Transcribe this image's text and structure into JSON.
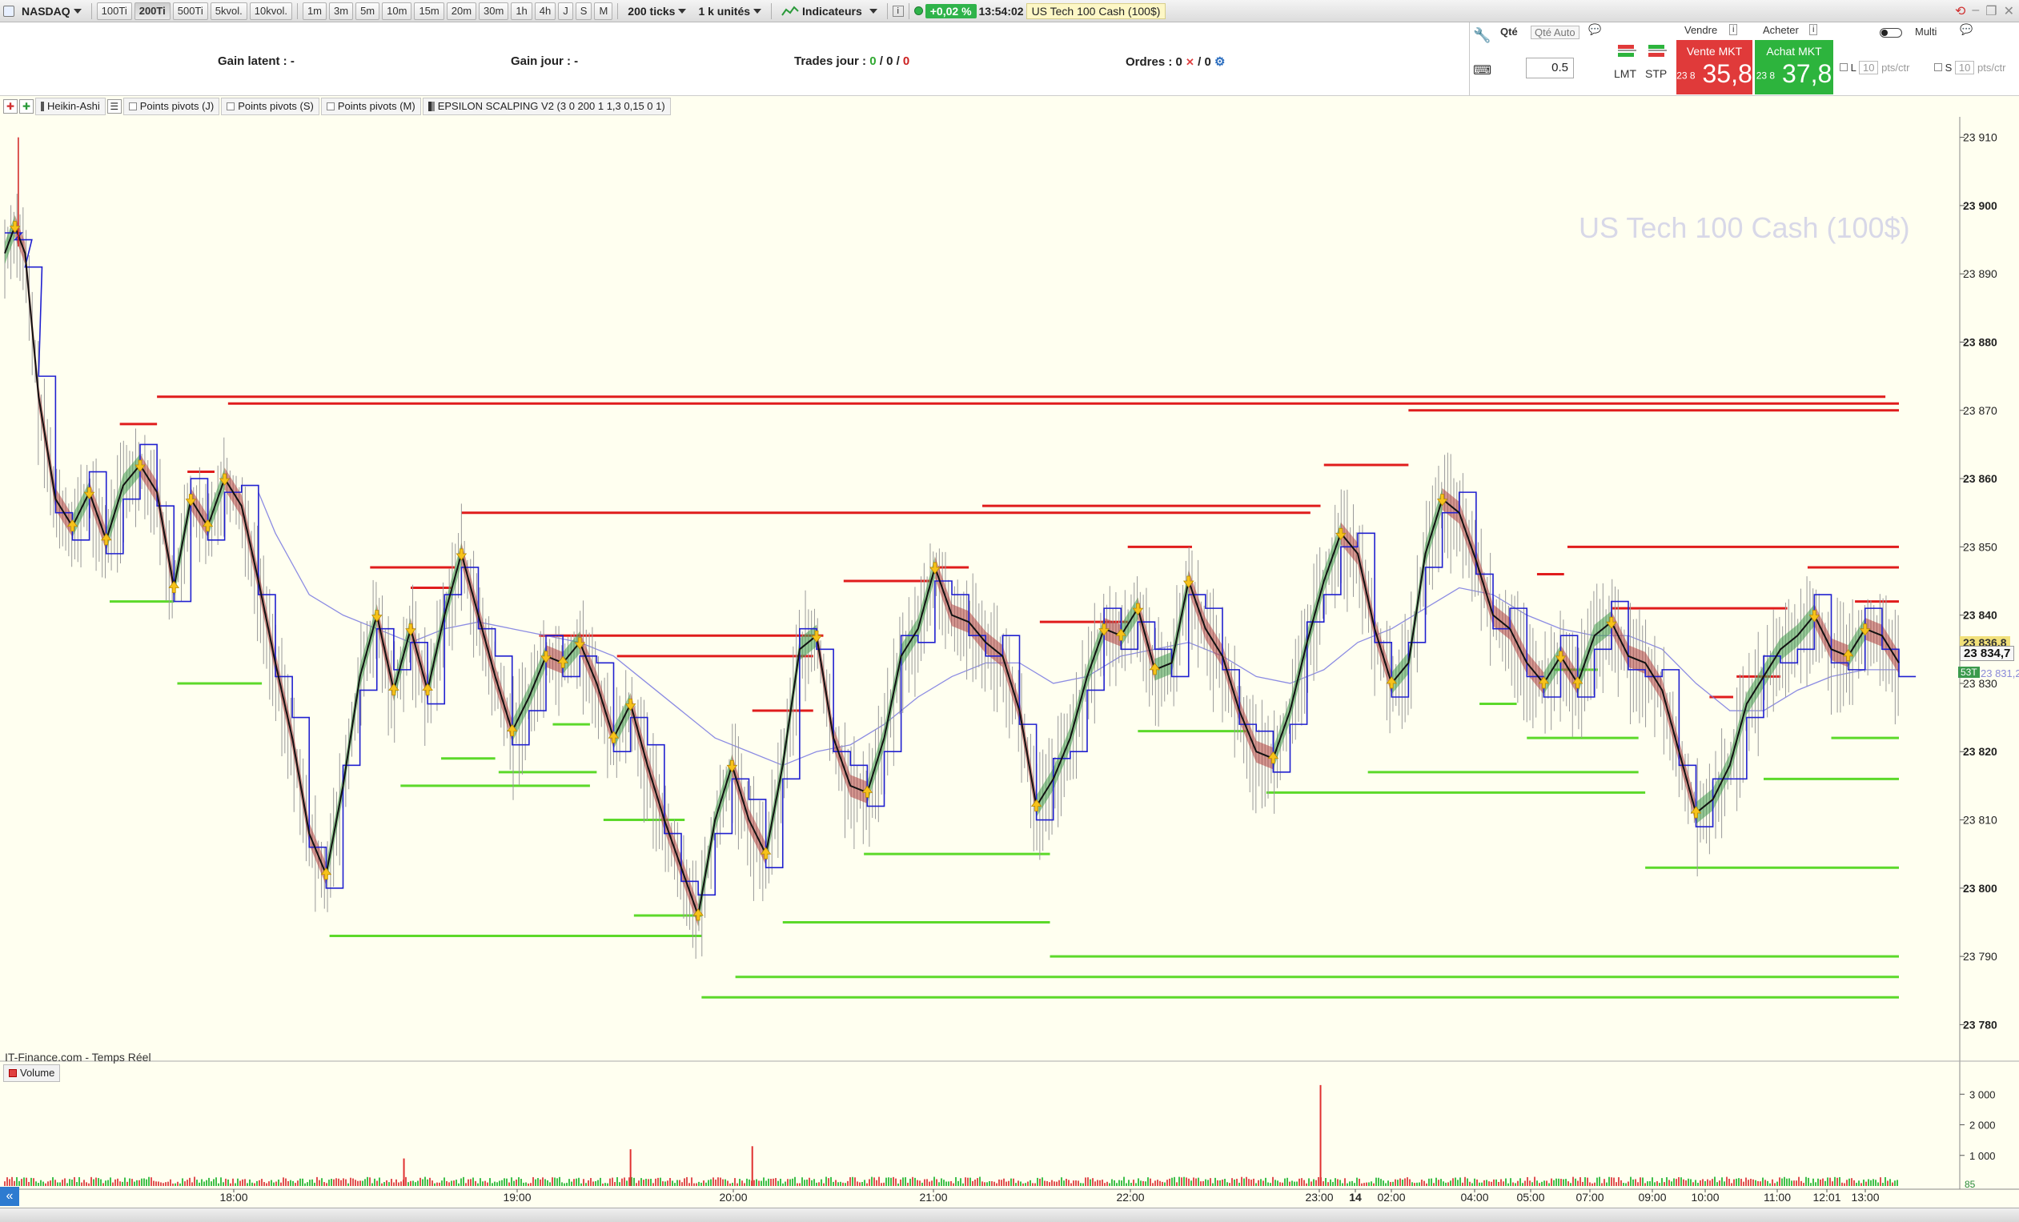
{
  "toolbar": {
    "market": "NASDAQ",
    "tick_buttons": [
      "100Ti",
      "200Ti",
      "500Ti",
      "5kvol.",
      "10kvol."
    ],
    "active_tick": "200Ti",
    "timeframes": [
      "1m",
      "3m",
      "5m",
      "10m",
      "15m",
      "20m",
      "30m",
      "1h",
      "4h",
      "J",
      "S",
      "M"
    ],
    "ticks_select": "200 ticks",
    "units_select": "1 k unités",
    "indicators_label": "Indicateurs",
    "change_pct": "+0,02 %",
    "clock": "13:54:02",
    "instrument": "US Tech 100 Cash (100$)"
  },
  "info": {
    "gain_latent": "Gain latent : -",
    "gain_jour": "Gain jour : -",
    "trades_label": "Trades jour :",
    "trades_values": [
      "0",
      "0",
      "0"
    ],
    "orders_label": "Ordres : 0",
    "orders_second": "/ 0"
  },
  "order_panel": {
    "qty_label": "Qté",
    "qty_value": "0.5",
    "qty_tab": "Qté Auto",
    "lmt": "LMT",
    "stp": "STP",
    "sell_header": "Vendre",
    "buy_header": "Acheter",
    "sell_title": "Vente MKT",
    "buy_title": "Achat MKT",
    "sell_prefix": "23 8",
    "sell_price": "35,8",
    "buy_prefix": "23 8",
    "buy_price": "37,8",
    "multi": "Multi",
    "l_label": "L",
    "s_label": "S",
    "l_value": "10",
    "s_value": "10",
    "pts_unit": "pts/ctr"
  },
  "indicators": {
    "heikin": "Heikin-Ashi",
    "pivots_j": "Points pivots (J)",
    "pivots_s": "Points pivots (S)",
    "pivots_m": "Points pivots (M)",
    "epsilon": "EPSILON SCALPING V2 (3 0 200 1 1,3 0,15 0 1)"
  },
  "chart": {
    "watermark": "US Tech 100 Cash (100$)",
    "source": "IT-Finance.com - Temps Réel",
    "volume_label": "Volume",
    "last_price_tag": "23 834,7",
    "upper_tag": "23 836,8",
    "stat_tag": "53T",
    "lower_tag": "23 831,2",
    "colors": {
      "resistance": "#e01c1c",
      "support": "#5cd92a",
      "ma": "#6f6fe0",
      "bull": "#3f9a4d",
      "bear": "#b04040",
      "bg": "#fffff0"
    }
  },
  "chart_data": {
    "type": "line",
    "title": "US Tech 100 Cash (100$)",
    "xlabel": "",
    "ylabel": "",
    "y_ticks": [
      "23 910",
      "23 900",
      "23 890",
      "23 880",
      "23 870",
      "23 860",
      "23 850",
      "23 840",
      "23 830",
      "23 820",
      "23 810",
      "23 800",
      "23 790",
      "23 780"
    ],
    "ylim": [
      23777,
      23913
    ],
    "x_tick_labels": [
      "18:00",
      "19:00",
      "20:00",
      "21:00",
      "22:00",
      "23:00",
      "14",
      "02:00",
      "04:00",
      "05:00",
      "07:00",
      "09:00",
      "10:00",
      "11:00",
      "12:01",
      "13:00"
    ],
    "volume_ticks": [
      "3 000",
      "2 000",
      "1 000"
    ],
    "volume_ylim": [
      0,
      3400
    ],
    "volume_stat": "85",
    "price_path": [
      [
        0,
        23893
      ],
      [
        0.3,
        23897
      ],
      [
        0.6,
        23893
      ],
      [
        1,
        23872
      ],
      [
        1.5,
        23857
      ],
      [
        2,
        23853
      ],
      [
        2.5,
        23858
      ],
      [
        3,
        23851
      ],
      [
        3.5,
        23859
      ],
      [
        4,
        23862
      ],
      [
        4.5,
        23858
      ],
      [
        5,
        23844
      ],
      [
        5.5,
        23857
      ],
      [
        6,
        23853
      ],
      [
        6.5,
        23860
      ],
      [
        7,
        23856
      ],
      [
        7.5,
        23845
      ],
      [
        8,
        23833
      ],
      [
        8.5,
        23822
      ],
      [
        9,
        23808
      ],
      [
        9.5,
        23802
      ],
      [
        10,
        23815
      ],
      [
        10.5,
        23831
      ],
      [
        11,
        23840
      ],
      [
        11.5,
        23829
      ],
      [
        12,
        23838
      ],
      [
        12.5,
        23829
      ],
      [
        13,
        23840
      ],
      [
        13.5,
        23849
      ],
      [
        14,
        23840
      ],
      [
        14.5,
        23831
      ],
      [
        15,
        23823
      ],
      [
        15.5,
        23828
      ],
      [
        16,
        23834
      ],
      [
        16.5,
        23833
      ],
      [
        17,
        23836
      ],
      [
        17.5,
        23830
      ],
      [
        18,
        23822
      ],
      [
        18.5,
        23827
      ],
      [
        19,
        23818
      ],
      [
        19.5,
        23810
      ],
      [
        20,
        23803
      ],
      [
        20.5,
        23796
      ],
      [
        21,
        23810
      ],
      [
        21.5,
        23818
      ],
      [
        22,
        23810
      ],
      [
        22.5,
        23805
      ],
      [
        23,
        23818
      ],
      [
        23.5,
        23835
      ],
      [
        24,
        23837
      ],
      [
        24.5,
        23822
      ],
      [
        25,
        23815
      ],
      [
        25.5,
        23814
      ],
      [
        26,
        23822
      ],
      [
        26.5,
        23834
      ],
      [
        27,
        23838
      ],
      [
        27.5,
        23847
      ],
      [
        28,
        23840
      ],
      [
        28.5,
        23839
      ],
      [
        29,
        23836
      ],
      [
        29.5,
        23834
      ],
      [
        30,
        23826
      ],
      [
        30.5,
        23812
      ],
      [
        31,
        23816
      ],
      [
        31.5,
        23822
      ],
      [
        32,
        23831
      ],
      [
        32.5,
        23838
      ],
      [
        33,
        23837
      ],
      [
        33.5,
        23841
      ],
      [
        34,
        23832
      ],
      [
        34.5,
        23833
      ],
      [
        35,
        23845
      ],
      [
        35.5,
        23838
      ],
      [
        36,
        23834
      ],
      [
        36.5,
        23826
      ],
      [
        37,
        23820
      ],
      [
        37.5,
        23819
      ],
      [
        38,
        23826
      ],
      [
        38.5,
        23836
      ],
      [
        39,
        23845
      ],
      [
        39.5,
        23852
      ],
      [
        40,
        23849
      ],
      [
        40.5,
        23838
      ],
      [
        41,
        23830
      ],
      [
        41.5,
        23833
      ],
      [
        42,
        23849
      ],
      [
        42.5,
        23857
      ],
      [
        43,
        23855
      ],
      [
        43.5,
        23848
      ],
      [
        44,
        23840
      ],
      [
        44.5,
        23838
      ],
      [
        45,
        23833
      ],
      [
        45.5,
        23830
      ],
      [
        46,
        23834
      ],
      [
        46.5,
        23830
      ],
      [
        47,
        23837
      ],
      [
        47.5,
        23839
      ],
      [
        48,
        23834
      ],
      [
        48.5,
        23833
      ],
      [
        49,
        23829
      ],
      [
        49.5,
        23820
      ],
      [
        50,
        23811
      ],
      [
        50.5,
        23813
      ],
      [
        51,
        23818
      ],
      [
        51.5,
        23827
      ],
      [
        52,
        23831
      ],
      [
        52.5,
        23835
      ],
      [
        53,
        23837
      ],
      [
        53.5,
        23840
      ],
      [
        54,
        23835
      ],
      [
        54.5,
        23834
      ],
      [
        55,
        23838
      ],
      [
        55.5,
        23837
      ],
      [
        56,
        23833
      ]
    ],
    "ma_path": [
      [
        7.5,
        23858
      ],
      [
        8,
        23852
      ],
      [
        9,
        23843
      ],
      [
        10,
        23840
      ],
      [
        11,
        23838
      ],
      [
        12,
        23836
      ],
      [
        13,
        23838
      ],
      [
        14,
        23839
      ],
      [
        15,
        23838
      ],
      [
        16,
        23837
      ],
      [
        17,
        23836
      ],
      [
        18,
        23834
      ],
      [
        19,
        23830
      ],
      [
        20,
        23826
      ],
      [
        21,
        23822
      ],
      [
        22,
        23820
      ],
      [
        23,
        23818
      ],
      [
        24,
        23820
      ],
      [
        25,
        23821
      ],
      [
        26,
        23824
      ],
      [
        27,
        23828
      ],
      [
        28,
        23831
      ],
      [
        29,
        23833
      ],
      [
        30,
        23833
      ],
      [
        31,
        23830
      ],
      [
        32,
        23831
      ],
      [
        33,
        23834
      ],
      [
        34,
        23835
      ],
      [
        35,
        23836
      ],
      [
        36,
        23834
      ],
      [
        37,
        23831
      ],
      [
        38,
        23830
      ],
      [
        39,
        23832
      ],
      [
        40,
        23836
      ],
      [
        41,
        23838
      ],
      [
        42,
        23841
      ],
      [
        43,
        23844
      ],
      [
        44,
        23843
      ],
      [
        45,
        23840
      ],
      [
        46,
        23838
      ],
      [
        47,
        23837
      ],
      [
        48,
        23837
      ],
      [
        49,
        23835
      ],
      [
        50,
        23830
      ],
      [
        51,
        23826
      ],
      [
        52,
        23826
      ],
      [
        53,
        23829
      ],
      [
        54,
        23831
      ],
      [
        55,
        23832
      ],
      [
        56,
        23832
      ]
    ],
    "resistance_levels": [
      [
        3.4,
        4.5,
        23868
      ],
      [
        4.5,
        55.6,
        23872
      ],
      [
        5.4,
        6.2,
        23861
      ],
      [
        6.6,
        56,
        23871
      ],
      [
        10.8,
        13.3,
        23847
      ],
      [
        12,
        13.2,
        23844
      ],
      [
        13.5,
        38.6,
        23855
      ],
      [
        15.8,
        24.2,
        23837
      ],
      [
        18.1,
        23.9,
        23834
      ],
      [
        22.1,
        23.9,
        23826
      ],
      [
        24.8,
        27.4,
        23845
      ],
      [
        27.6,
        28.5,
        23847
      ],
      [
        28.9,
        38.9,
        23856
      ],
      [
        30.6,
        33.2,
        23839
      ],
      [
        33.2,
        35.1,
        23850
      ],
      [
        39,
        41.5,
        23862
      ],
      [
        41.5,
        56,
        23870
      ],
      [
        45.3,
        46.1,
        23846
      ],
      [
        46.2,
        56,
        23850
      ],
      [
        47.5,
        52.7,
        23841
      ],
      [
        50.4,
        51.1,
        23828
      ],
      [
        51.2,
        52.5,
        23831
      ],
      [
        53.3,
        56,
        23847
      ],
      [
        54.7,
        56,
        23842
      ]
    ],
    "support_levels": [
      [
        3.1,
        5,
        23842
      ],
      [
        5.1,
        7.6,
        23830
      ],
      [
        9.6,
        20.6,
        23793
      ],
      [
        11.7,
        17.3,
        23815
      ],
      [
        12.9,
        14.5,
        23819
      ],
      [
        14.6,
        17.5,
        23817
      ],
      [
        16.2,
        17.3,
        23824
      ],
      [
        17.7,
        20.1,
        23810
      ],
      [
        18.6,
        20.6,
        23796
      ],
      [
        20.6,
        56,
        23784
      ],
      [
        21.6,
        56,
        23787
      ],
      [
        23,
        30.9,
        23795
      ],
      [
        25.4,
        30.9,
        23805
      ],
      [
        30.9,
        56,
        23790
      ],
      [
        33.5,
        36.7,
        23823
      ],
      [
        37.3,
        48.5,
        23814
      ],
      [
        40.3,
        48.3,
        23817
      ],
      [
        43.6,
        44.7,
        23827
      ],
      [
        45,
        48.3,
        23822
      ],
      [
        45.8,
        47.1,
        23832
      ],
      [
        48.5,
        56,
        23803
      ],
      [
        52,
        56,
        23816
      ],
      [
        54,
        56,
        23822
      ]
    ],
    "volume_spikes": [
      [
        38.9,
        3300
      ],
      [
        22.1,
        1300
      ],
      [
        18.5,
        1200
      ],
      [
        11.8,
        900
      ]
    ]
  }
}
